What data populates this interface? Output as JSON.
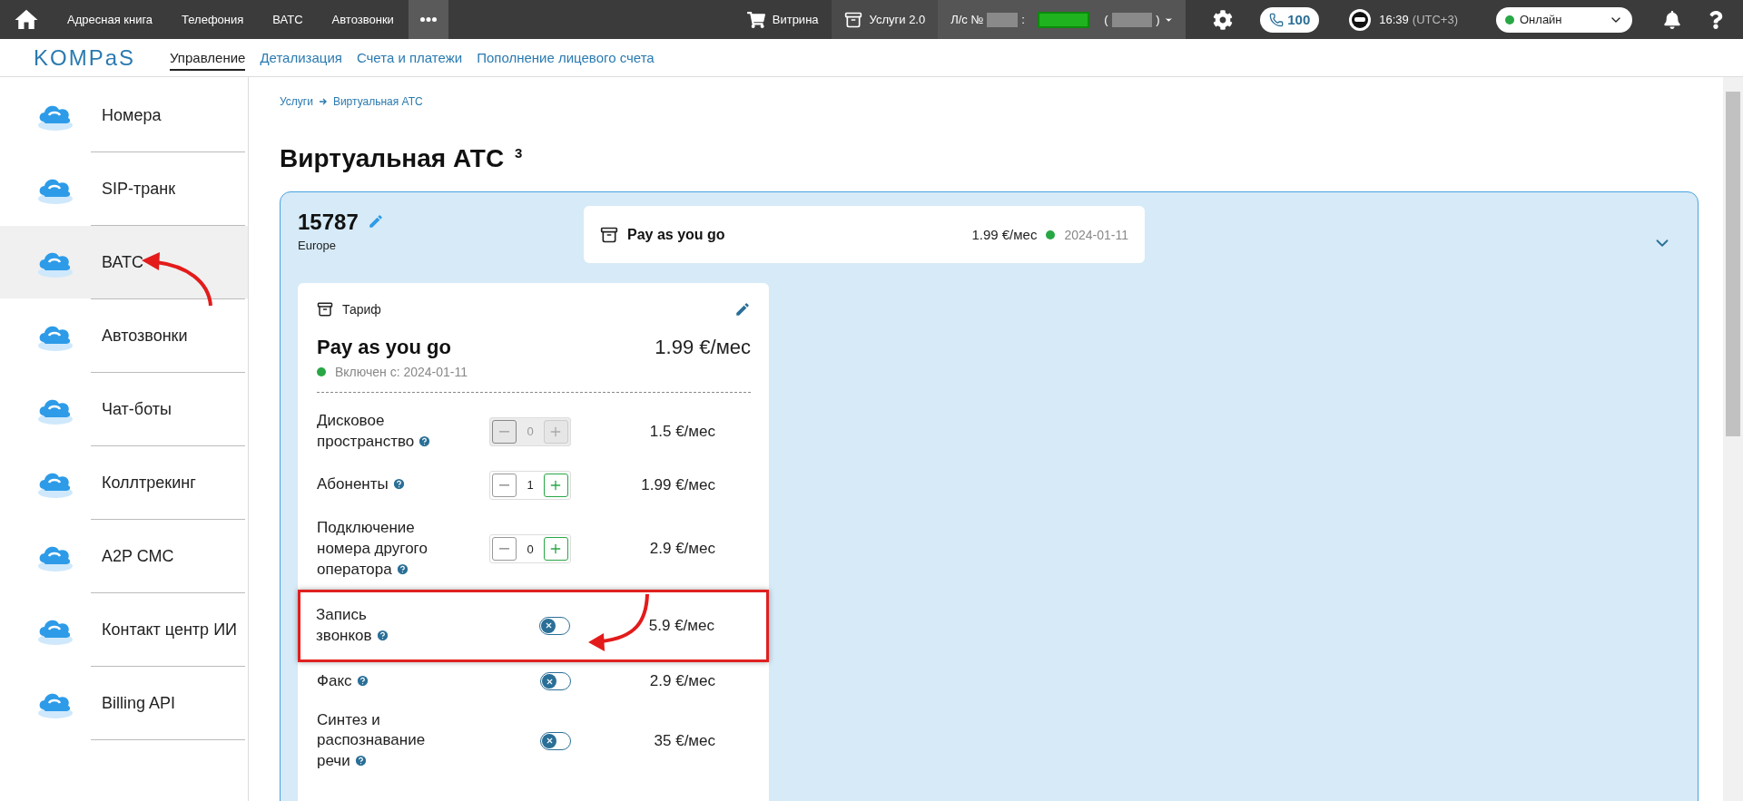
{
  "top_bar": {
    "nav": [
      {
        "label": "Адресная книга"
      },
      {
        "label": "Телефония"
      },
      {
        "label": "ВАТС"
      },
      {
        "label": "Автозвонки"
      }
    ],
    "showcase": "Витрина",
    "services": "Услуги 2.0",
    "account": {
      "label": "Л/с №",
      "separator": ":",
      "open": "(",
      "close": ")"
    },
    "calls_count": "100",
    "time": "16:39",
    "timezone": "(UTC+3)",
    "status": "Онлайн"
  },
  "logo": "KOMPaS",
  "tabs": [
    {
      "label": "Управление",
      "selected": true
    },
    {
      "label": "Детализация",
      "selected": false
    },
    {
      "label": "Счета и платежи",
      "selected": false
    },
    {
      "label": "Пополнение лицевого счета",
      "selected": false
    }
  ],
  "sidebar": {
    "items": [
      {
        "label": "Номера",
        "selected": false
      },
      {
        "label": "SIP-транк",
        "selected": false
      },
      {
        "label": "ВАТС",
        "selected": true
      },
      {
        "label": "Автозвонки",
        "selected": false
      },
      {
        "label": "Чат-боты",
        "selected": false
      },
      {
        "label": "Коллтрекинг",
        "selected": false
      },
      {
        "label": "A2P СМС",
        "selected": false
      },
      {
        "label": "Контакт центр ИИ",
        "selected": false
      },
      {
        "label": "Billing API",
        "selected": false
      }
    ]
  },
  "breadcrumb": [
    "Услуги",
    "Виртуальная АТС"
  ],
  "title": "Виртуальная АТС $^{3}$",
  "pbx": {
    "number": "15787",
    "region": "Europe",
    "summary": {
      "name": "Pay as you go",
      "price": "1.99 €/мес",
      "date": "2024-01-11"
    }
  },
  "tariff": {
    "heading": "Тариф",
    "name": "Pay as you go",
    "price": "1.99 €/мес",
    "status": "Включен с: 2024-01-11",
    "options": [
      {
        "kind": "stepper",
        "label": "Дисковое\nпространство",
        "value": "0",
        "disabled": true,
        "highlighted": false,
        "price": "1.5 €/мес"
      },
      {
        "kind": "stepper",
        "label": "Абоненты",
        "value": "1",
        "disabled": false,
        "highlighted": false,
        "price": "1.99 €/мес"
      },
      {
        "kind": "stepper",
        "label": "Подключение\nномера другого\nоператора",
        "value": "0",
        "disabled": false,
        "highlighted": false,
        "price": "2.9 €/мес"
      },
      {
        "kind": "toggle",
        "label": "Запись\nзвонков",
        "on": false,
        "highlighted": true,
        "price": "5.9 €/мес"
      },
      {
        "kind": "toggle",
        "label": "Факс",
        "on": false,
        "highlighted": false,
        "price": "2.9 €/мес"
      },
      {
        "kind": "toggle",
        "label": "Синтез и\nраспознавание\nречи",
        "on": false,
        "highlighted": false,
        "price": "35 €/мес"
      }
    ]
  }
}
